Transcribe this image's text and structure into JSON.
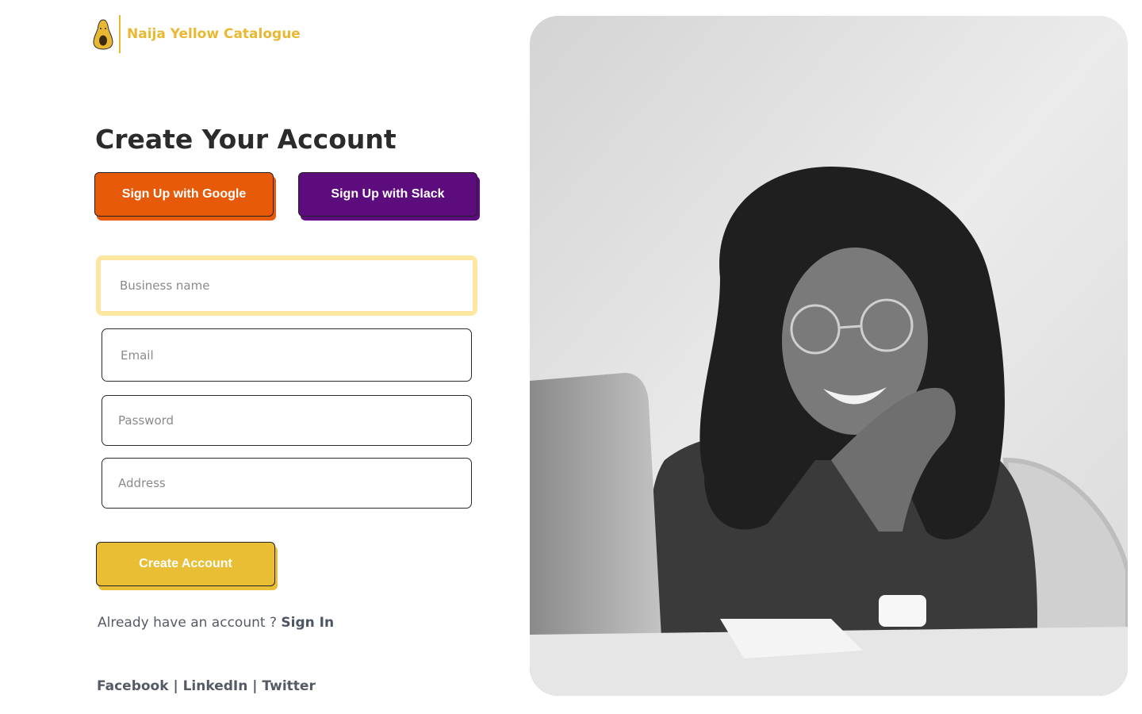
{
  "brand": {
    "name": "Naija Yellow Catalogue",
    "color": "#e9b832"
  },
  "page_title": "Create Your Account",
  "oauth": {
    "google_label": "Sign Up with Google",
    "google_color": "#e65a09",
    "slack_label": "Sign Up with Slack",
    "slack_color": "#5c0c7c"
  },
  "form": {
    "business_name_placeholder": "Business name",
    "email_placeholder": "Email",
    "password_placeholder": "Password",
    "address_placeholder": "Address",
    "submit_label": "Create Account",
    "submit_color": "#e9bd34"
  },
  "signin": {
    "prompt": "Already have an account ?",
    "link_label": "Sign In"
  },
  "social": {
    "facebook": "Facebook",
    "linkedin": "LinkedIn",
    "twitter": "Twitter",
    "separator": "|"
  },
  "hero": {
    "icon": "photo-of-smiling-woman-with-laptop"
  }
}
